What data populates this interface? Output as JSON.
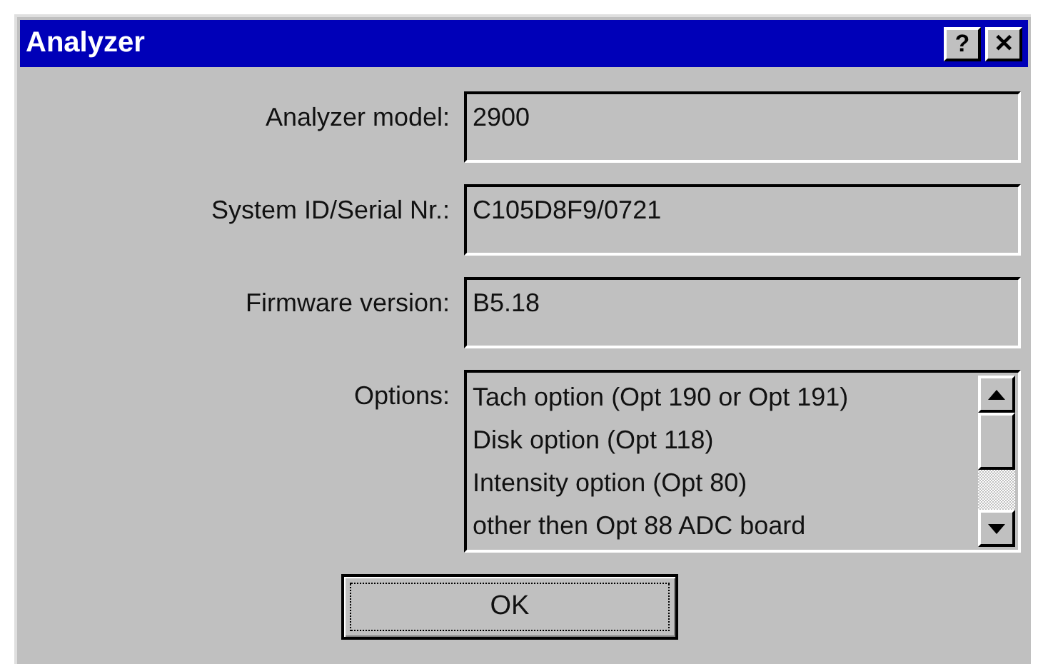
{
  "window": {
    "title": "Analyzer",
    "help_button": "?",
    "close_button": "✕"
  },
  "fields": [
    {
      "label": "Analyzer model:",
      "value": "2900"
    },
    {
      "label": "System ID/Serial Nr.:",
      "value": "C105D8F9/0721"
    },
    {
      "label": "Firmware version:",
      "value": "B5.18"
    }
  ],
  "options": {
    "label": "Options:",
    "items": [
      "Tach option (Opt 190 or Opt 191)",
      "Disk option (Opt 118)",
      "Intensity option (Opt 80)",
      "other then Opt 88 ADC board"
    ]
  },
  "buttons": [
    "OK"
  ]
}
